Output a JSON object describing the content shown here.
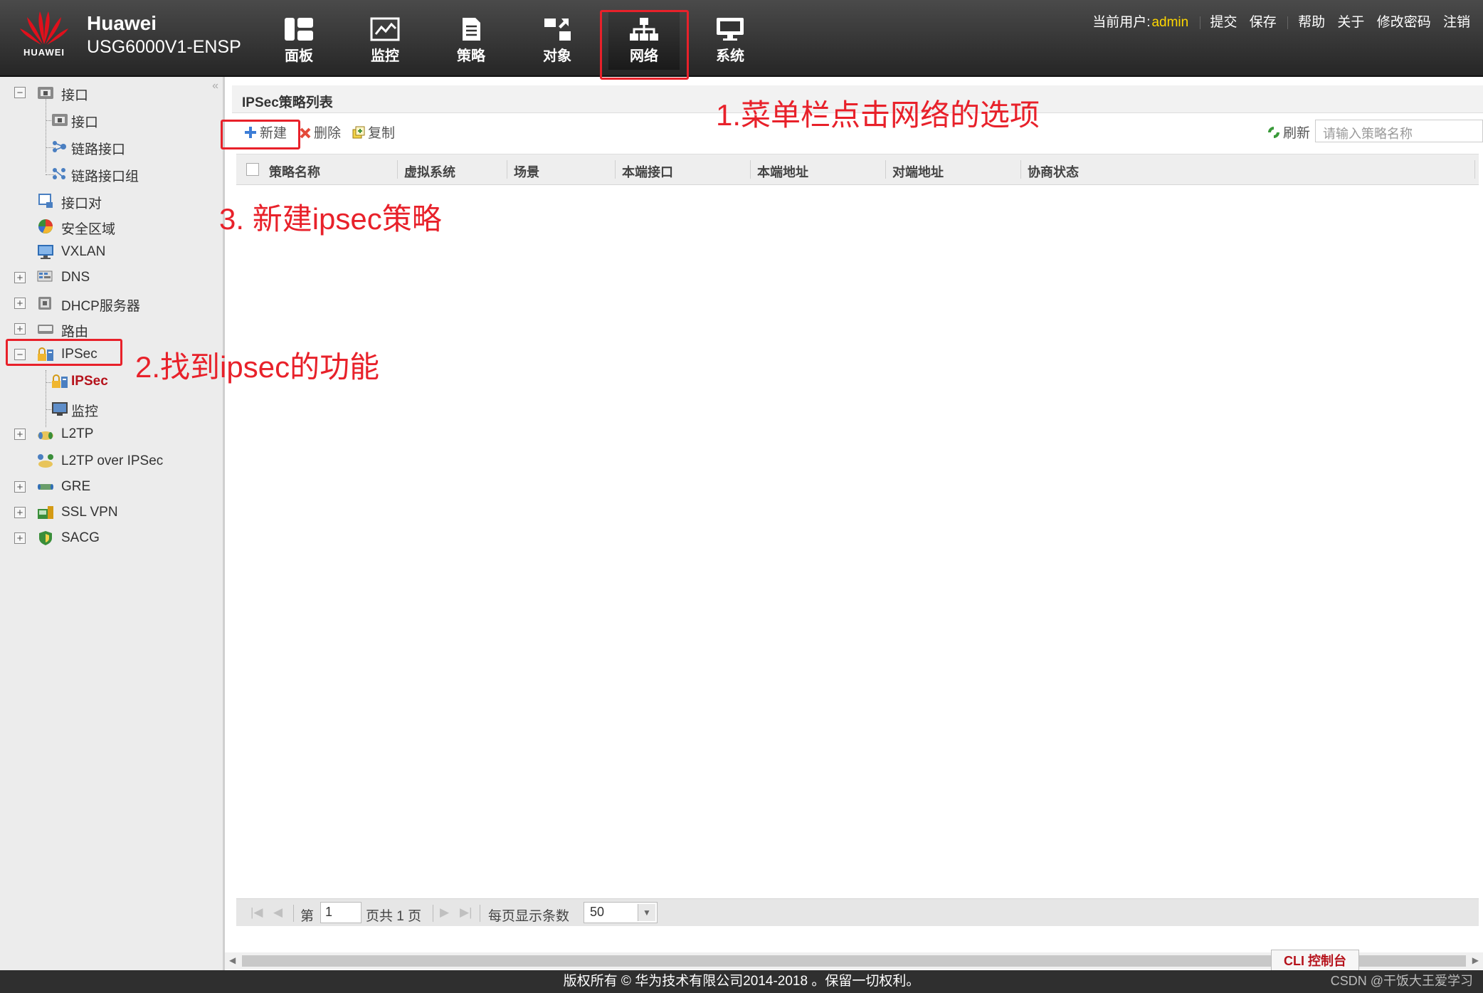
{
  "header": {
    "logo_text": "HUAWEI",
    "brand_name": "Huawei",
    "device_model": "USG6000V1-ENSP",
    "nav": [
      {
        "label": "面板",
        "icon": "dashboard-icon"
      },
      {
        "label": "监控",
        "icon": "monitor-chart-icon"
      },
      {
        "label": "策略",
        "icon": "policy-document-icon"
      },
      {
        "label": "对象",
        "icon": "object-blocks-icon"
      },
      {
        "label": "网络",
        "icon": "network-topology-icon",
        "active": true
      },
      {
        "label": "系统",
        "icon": "system-monitor-icon"
      }
    ],
    "user_label": "当前用户:",
    "user_name": "admin",
    "actions": {
      "submit": "提交",
      "save": "保存",
      "help": "帮助",
      "about": "关于",
      "change_password": "修改密码",
      "logout": "注销"
    }
  },
  "sidebar": {
    "collapse": "«",
    "items": [
      {
        "label": "接口",
        "toggle": "−"
      },
      {
        "label": "接口"
      },
      {
        "label": "链路接口"
      },
      {
        "label": "链路接口组"
      },
      {
        "label": "接口对"
      },
      {
        "label": "安全区域"
      },
      {
        "label": "VXLAN"
      },
      {
        "label": "DNS",
        "toggle": "+"
      },
      {
        "label": "DHCP服务器",
        "toggle": "+"
      },
      {
        "label": "路由",
        "toggle": "+"
      },
      {
        "label": "IPSec",
        "toggle": "−"
      },
      {
        "label": "IPSec",
        "selected": true
      },
      {
        "label": "监控"
      },
      {
        "label": "L2TP",
        "toggle": "+"
      },
      {
        "label": "L2TP over IPSec"
      },
      {
        "label": "GRE",
        "toggle": "+"
      },
      {
        "label": "SSL VPN",
        "toggle": "+"
      },
      {
        "label": "SACG",
        "toggle": "+"
      }
    ]
  },
  "main": {
    "title": "IPSec策略列表",
    "toolbar": {
      "new": "新建",
      "delete": "删除",
      "copy": "复制",
      "refresh": "刷新",
      "search_placeholder": "请输入策略名称"
    },
    "columns": [
      "策略名称",
      "虚拟系统",
      "场景",
      "本端接口",
      "本端地址",
      "对端地址",
      "协商状态"
    ],
    "rows": [],
    "pager": {
      "page_prefix": "第",
      "page_value": "1",
      "page_suffix": "页共 1 页",
      "page_size_label": "每页显示条数",
      "page_size": "50"
    },
    "cli_tab": "CLI 控制台"
  },
  "annotations": {
    "a1": "1.菜单栏点击网络的选项",
    "a2": "2.找到ipsec的功能",
    "a3": "3. 新建ipsec策略"
  },
  "footer": {
    "copyright": "版权所有 © 华为技术有限公司2014-2018 。保留一切权利。",
    "watermark": "CSDN @干饭大王爱学习"
  },
  "colors": {
    "accent_red": "#e8212a",
    "selected_red": "#b5121b",
    "user_yellow": "#ffd700",
    "header_dark": "#262626"
  }
}
